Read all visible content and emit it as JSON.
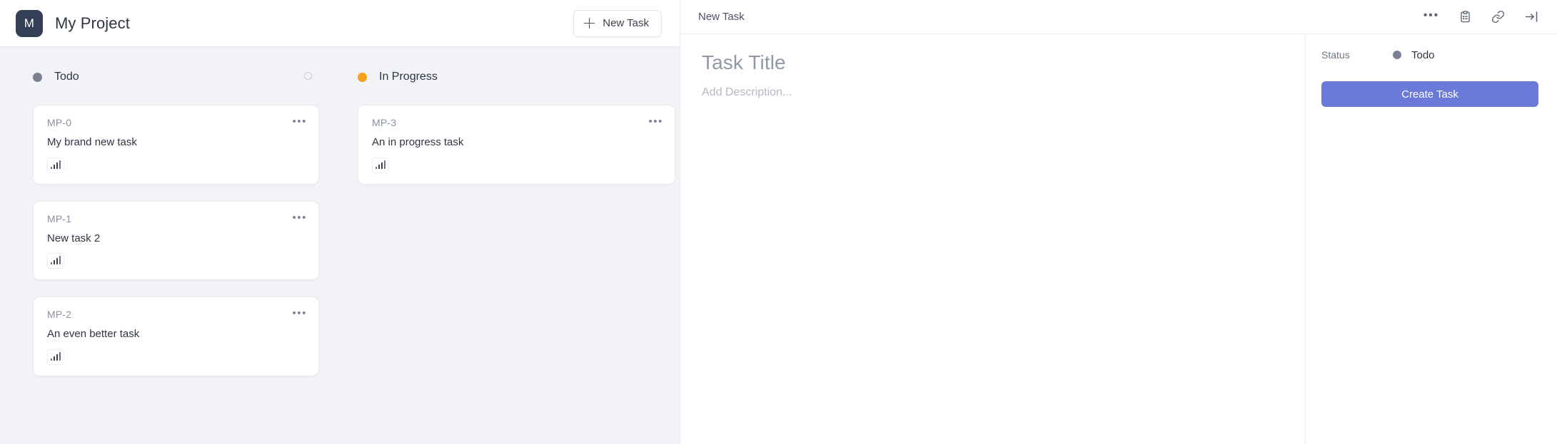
{
  "board": {
    "header": {
      "logo_letter": "M",
      "project_title": "My Project",
      "new_task_label": "New Task"
    },
    "columns": [
      {
        "id": "todo",
        "title": "Todo",
        "dot_color": "#7a8194",
        "has_spinner": true,
        "cards": [
          {
            "key": "MP-0",
            "title": "My brand new task",
            "menu": "•••",
            "priority_icon": "bar-chart-icon"
          },
          {
            "key": "MP-1",
            "title": "New task 2",
            "menu": "•••",
            "priority_icon": "bar-chart-icon"
          },
          {
            "key": "MP-2",
            "title": "An even better task",
            "menu": "•••",
            "priority_icon": "bar-chart-icon"
          }
        ]
      },
      {
        "id": "in-progress",
        "title": "In Progress",
        "dot_color": "#f6a01a",
        "has_spinner": false,
        "cards": [
          {
            "key": "MP-3",
            "title": "An in progress task",
            "menu": "•••",
            "priority_icon": "bar-chart-icon"
          }
        ]
      }
    ]
  },
  "panel": {
    "header": {
      "title": "New Task",
      "more_label": "•••",
      "icons": [
        "more-horizontal-icon",
        "clipboard-list-icon",
        "link-icon",
        "collapse-panel-icon"
      ]
    },
    "task": {
      "title_placeholder": "Task Title",
      "title_value": "",
      "description_placeholder": "Add Description...",
      "description_value": ""
    },
    "side": {
      "status_label": "Status",
      "status_value": "Todo",
      "status_dot_color": "#7a8194",
      "create_label": "Create Task",
      "accent_color": "#6b79d8"
    }
  }
}
